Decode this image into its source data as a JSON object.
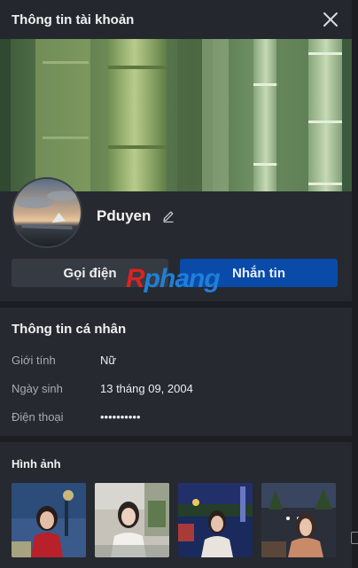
{
  "header": {
    "title": "Thông tin tài khoản"
  },
  "profile": {
    "name": "Pduyen"
  },
  "actions": {
    "call_label": "Gọi điện",
    "message_label": "Nhắn tin"
  },
  "watermark": {
    "first": "R",
    "rest": "phang"
  },
  "personal_info": {
    "title": "Thông tin cá nhân",
    "rows": [
      {
        "label": "Giới tính",
        "value": "Nữ"
      },
      {
        "label": "Ngày sinh",
        "value": "13 tháng 09, 2004"
      },
      {
        "label": "Điện thoại",
        "value": "••••••••••"
      }
    ]
  },
  "photos": {
    "title": "Hình ảnh"
  },
  "colors": {
    "accent": "#0a4aa8",
    "panel": "#26292f"
  }
}
